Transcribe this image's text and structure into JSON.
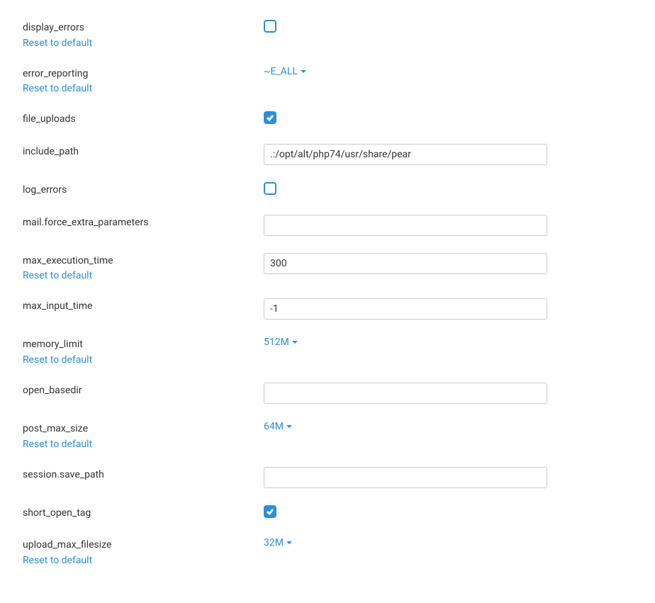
{
  "reset_label": "Reset to default",
  "settings": {
    "display_errors": {
      "label": "display_errors",
      "checked": false,
      "has_reset": true
    },
    "error_reporting": {
      "label": "error_reporting",
      "value": "~E_ALL",
      "has_reset": true
    },
    "file_uploads": {
      "label": "file_uploads",
      "checked": true,
      "has_reset": false
    },
    "include_path": {
      "label": "include_path",
      "value": ".:/opt/alt/php74/usr/share/pear",
      "has_reset": false
    },
    "log_errors": {
      "label": "log_errors",
      "checked": false,
      "has_reset": false
    },
    "mail_force_extra_parameters": {
      "label": "mail.force_extra_parameters",
      "value": "",
      "has_reset": false
    },
    "max_execution_time": {
      "label": "max_execution_time",
      "value": "300",
      "has_reset": true
    },
    "max_input_time": {
      "label": "max_input_time",
      "value": "-1",
      "has_reset": false
    },
    "memory_limit": {
      "label": "memory_limit",
      "value": "512M",
      "has_reset": true
    },
    "open_basedir": {
      "label": "open_basedir",
      "value": "",
      "has_reset": false
    },
    "post_max_size": {
      "label": "post_max_size",
      "value": "64M",
      "has_reset": true
    },
    "session_save_path": {
      "label": "session.save_path",
      "value": "",
      "has_reset": false
    },
    "short_open_tag": {
      "label": "short_open_tag",
      "checked": true,
      "has_reset": false
    },
    "upload_max_filesize": {
      "label": "upload_max_filesize",
      "value": "32M",
      "has_reset": true
    }
  }
}
